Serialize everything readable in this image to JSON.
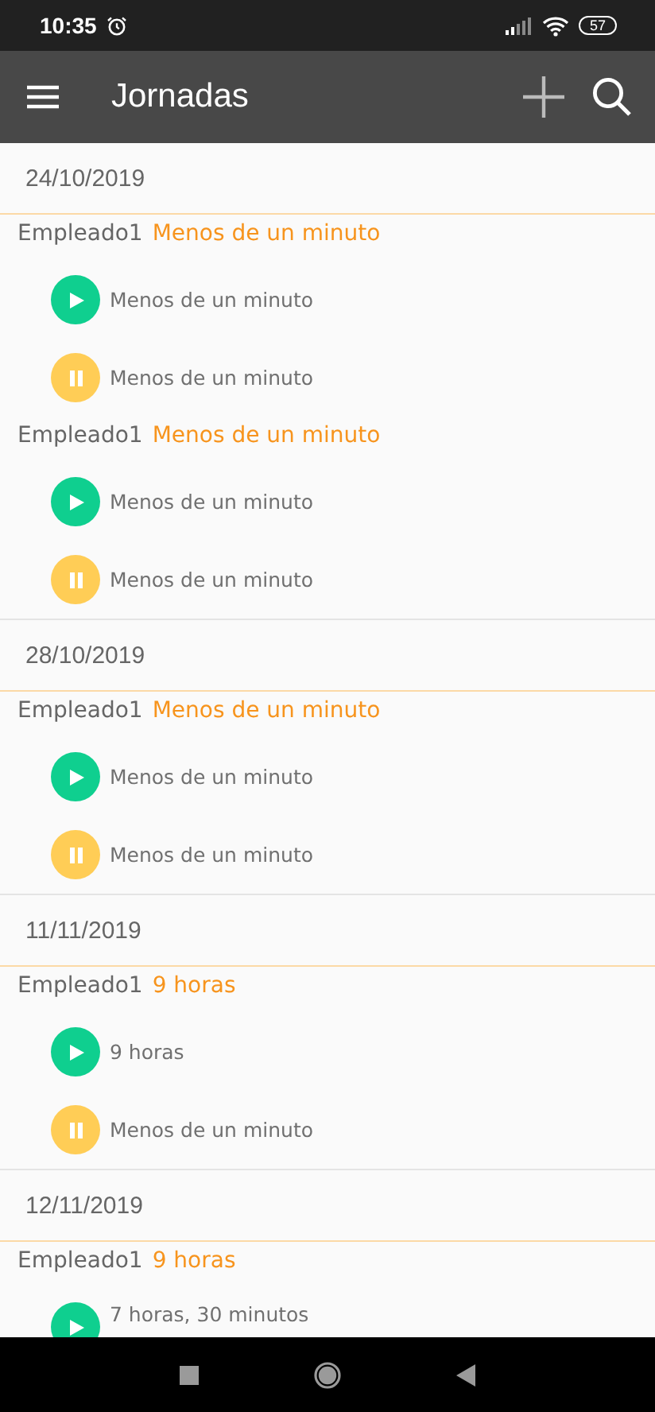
{
  "status_bar": {
    "time": "10:35",
    "battery": "57"
  },
  "app_bar": {
    "title": "Jornadas"
  },
  "days": [
    {
      "date": "24/10/2019",
      "shifts": [
        {
          "employee": "Empleado1",
          "duration": "Menos de un minuto",
          "events": [
            {
              "kind": "start",
              "text": "Menos de un minuto"
            },
            {
              "kind": "pause",
              "text": "Menos de un minuto"
            }
          ]
        },
        {
          "employee": "Empleado1",
          "duration": "Menos de un minuto",
          "events": [
            {
              "kind": "start",
              "text": "Menos de un minuto"
            },
            {
              "kind": "pause",
              "text": "Menos de un minuto"
            }
          ]
        }
      ]
    },
    {
      "date": "28/10/2019",
      "shifts": [
        {
          "employee": "Empleado1",
          "duration": "Menos de un minuto",
          "events": [
            {
              "kind": "start",
              "text": "Menos de un minuto"
            },
            {
              "kind": "pause",
              "text": "Menos de un minuto"
            }
          ]
        }
      ]
    },
    {
      "date": "11/11/2019",
      "shifts": [
        {
          "employee": "Empleado1",
          "duration": "9 horas",
          "events": [
            {
              "kind": "start",
              "text": "9 horas"
            },
            {
              "kind": "pause",
              "text": "Menos de un minuto"
            }
          ]
        }
      ]
    },
    {
      "date": "12/11/2019",
      "shifts": [
        {
          "employee": "Empleado1",
          "duration": "9 horas",
          "events": [
            {
              "kind": "start",
              "text": "7 horas, 30 minutos"
            }
          ]
        }
      ]
    }
  ]
}
